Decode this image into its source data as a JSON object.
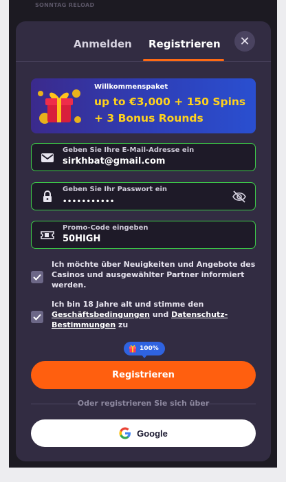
{
  "backdrop": {
    "text": "SONNTAG RELOAD"
  },
  "tabs": [
    {
      "label": "Anmelden",
      "active": false
    },
    {
      "label": "Registrieren",
      "active": true
    }
  ],
  "close": {
    "icon": "close-icon"
  },
  "banner": {
    "title": "Willkommenspaket",
    "offer": "up to €3,000 + 150 Spins + 3 Bonus Rounds",
    "icon": "gift-box-icon"
  },
  "fields": {
    "email": {
      "label": "Geben Sie Ihre E-Mail-Adresse ein",
      "value": "sirkhbat@gmail.com",
      "icon": "mail-icon"
    },
    "password": {
      "label": "Geben Sie Ihr Passwort ein",
      "value": "•••••••••••",
      "icon": "lock-icon",
      "toggle_icon": "eye-off-icon"
    },
    "promo": {
      "label": "Promo-Code eingeben",
      "value": "50HIGH",
      "icon": "ticket-icon"
    }
  },
  "consents": {
    "newsletter": {
      "checked": true,
      "text": "Ich möchte über Neuigkeiten und Angebote des Casinos und ausgewählter Partner informiert werden."
    },
    "terms": {
      "checked": true,
      "text_before": "Ich bin 18 Jahre alt und stimme den ",
      "link_terms": "Geschäftsbedingungen",
      "text_middle": " und ",
      "link_privacy": "Datenschutz-Bestimmungen",
      "text_after": " zu"
    }
  },
  "bonus_badge": {
    "value": "100%",
    "icon": "gift-icon"
  },
  "register_button": {
    "label": "Registrieren"
  },
  "alt_divider": {
    "label": "Oder registrieren Sie sich über"
  },
  "google_button": {
    "label": "Google",
    "icon": "google-icon"
  },
  "colors": {
    "accent": "#ff5f0f",
    "field_border": "#3ecf4a",
    "modal_bg": "#322c42",
    "banner_text": "#ffd21c",
    "badge": "#2f63e0"
  }
}
